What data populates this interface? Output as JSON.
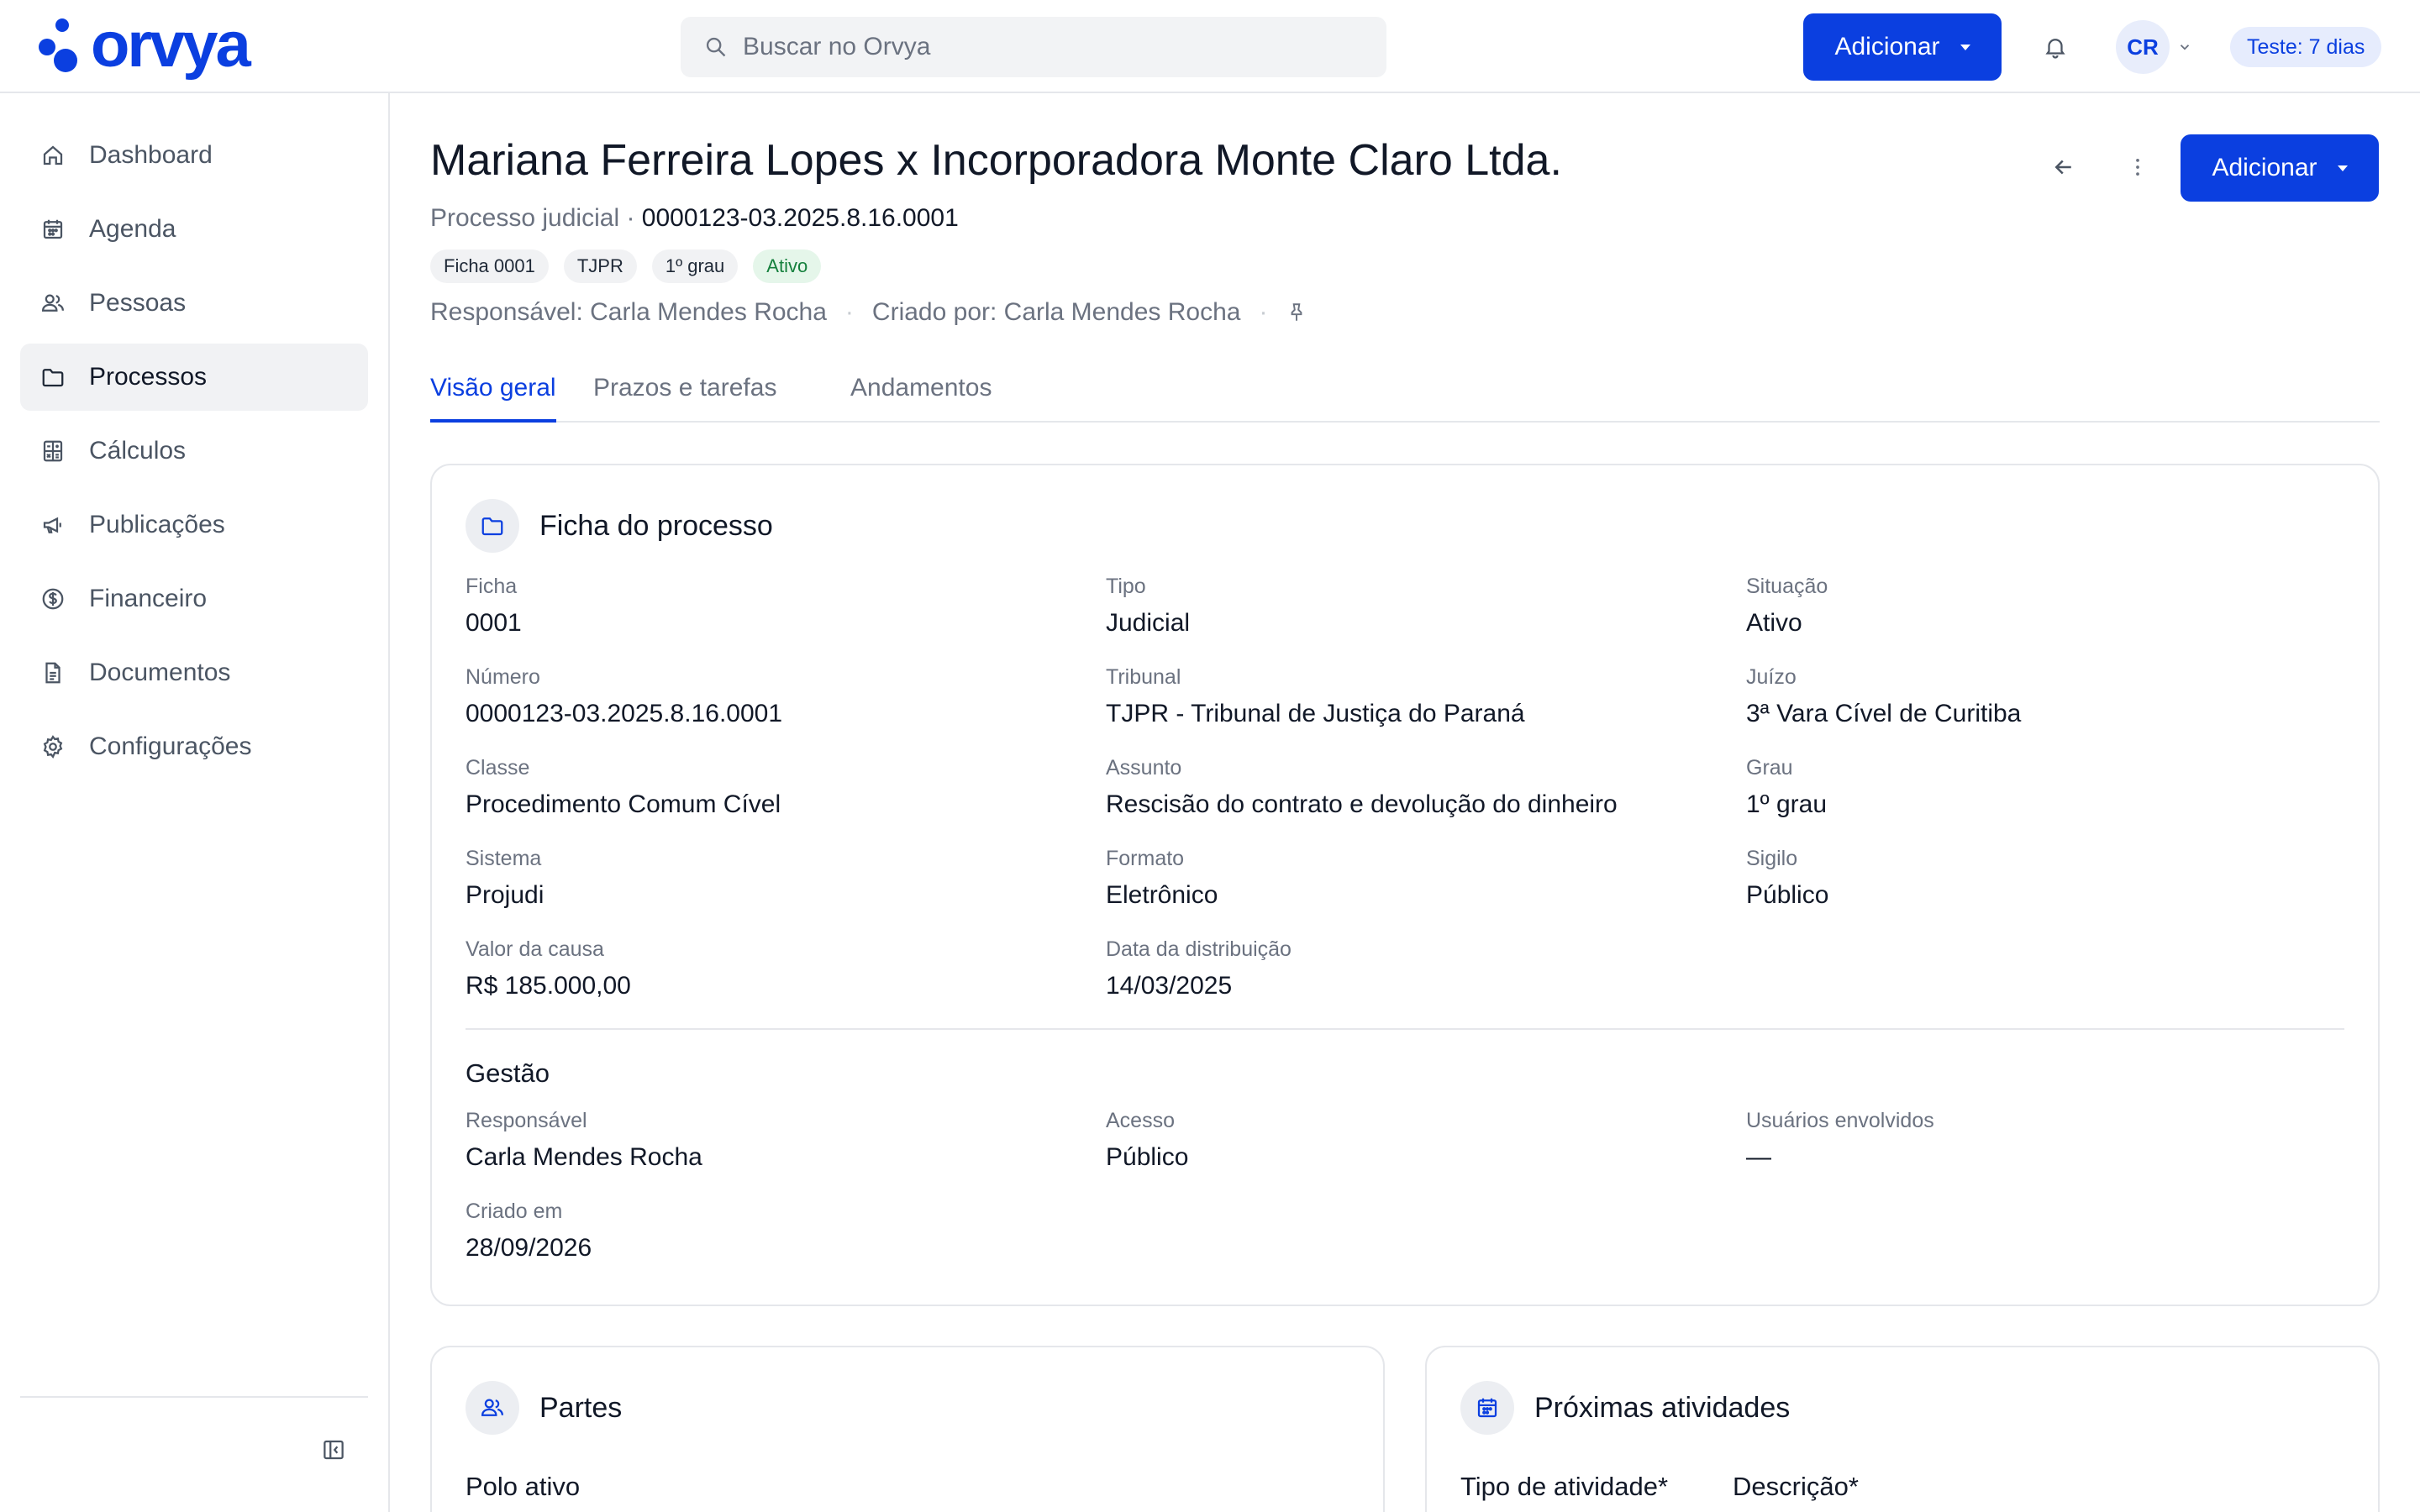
{
  "app": {
    "logo_text": "orvya"
  },
  "topbar": {
    "search_placeholder": "Buscar no Orvya",
    "add_label": "Adicionar",
    "avatar_initials": "CR",
    "trial_label": "Teste: 7 dias"
  },
  "sidebar": {
    "items": [
      {
        "label": "Dashboard",
        "icon": "home-icon"
      },
      {
        "label": "Agenda",
        "icon": "calendar-icon"
      },
      {
        "label": "Pessoas",
        "icon": "people-icon"
      },
      {
        "label": "Processos",
        "icon": "folder-icon",
        "active": true
      },
      {
        "label": "Cálculos",
        "icon": "calculator-icon"
      },
      {
        "label": "Publicações",
        "icon": "megaphone-icon"
      },
      {
        "label": "Financeiro",
        "icon": "dollar-icon"
      },
      {
        "label": "Documentos",
        "icon": "document-icon"
      },
      {
        "label": "Configurações",
        "icon": "gear-icon"
      }
    ]
  },
  "header": {
    "title": "Mariana Ferreira Lopes x Incorporadora Monte Claro Ltda.",
    "subtitle_type": "Processo judicial · ",
    "subtitle_number": "0000123-03.2025.8.16.0001",
    "chips": [
      "Ficha 0001",
      "TJPR",
      "1º grau",
      "Ativo"
    ],
    "responsavel": "Responsável: Carla Mendes Rocha",
    "criado_por": "Criado por: Carla Mendes Rocha",
    "separator": "·",
    "add_label": "Adicionar"
  },
  "tabs": [
    {
      "label": "Visão geral",
      "active": true
    },
    {
      "label": "Prazos e tarefas"
    },
    {
      "label": "Andamentos"
    }
  ],
  "ficha": {
    "title": "Ficha do processo",
    "fields": [
      {
        "label": "Ficha",
        "value": "0001"
      },
      {
        "label": "Tipo",
        "value": "Judicial"
      },
      {
        "label": "Situação",
        "value": "Ativo"
      },
      {
        "label": "Número",
        "value": "0000123-03.2025.8.16.0001"
      },
      {
        "label": "Tribunal",
        "value": "TJPR - Tribunal de Justiça do Paraná"
      },
      {
        "label": "Juízo",
        "value": "3ª Vara Cível de Curitiba"
      },
      {
        "label": "Classe",
        "value": "Procedimento Comum Cível"
      },
      {
        "label": "Assunto",
        "value": "Rescisão do contrato e devolução do dinheiro"
      },
      {
        "label": "Grau",
        "value": "1º grau"
      },
      {
        "label": "Sistema",
        "value": "Projudi"
      },
      {
        "label": "Formato",
        "value": "Eletrônico"
      },
      {
        "label": "Sigilo",
        "value": "Público"
      },
      {
        "label": "Valor da causa",
        "value": "R$ 185.000,00"
      },
      {
        "label": "Data da distribuição",
        "value": "14/03/2025"
      }
    ],
    "gestao_title": "Gestão",
    "gestao_fields": [
      {
        "label": "Responsável",
        "value": "Carla Mendes Rocha"
      },
      {
        "label": "Acesso",
        "value": "Público"
      },
      {
        "label": "Usuários envolvidos",
        "value": "—"
      },
      {
        "label": "Criado em",
        "value": "28/09/2026"
      }
    ]
  },
  "partes": {
    "title": "Partes",
    "polo_ativo": "Polo ativo"
  },
  "atividades": {
    "title": "Próximas atividades",
    "tipo_label": "Tipo de atividade*",
    "descricao_label": "Descrição*"
  }
}
